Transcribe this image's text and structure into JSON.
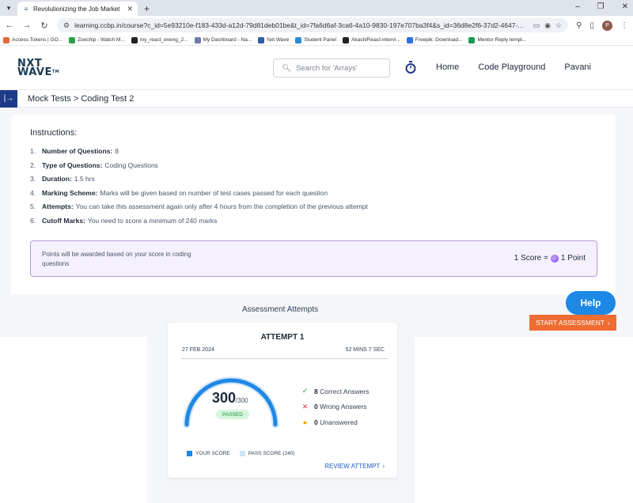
{
  "browser": {
    "tab_title": "Revolutionizing the Job Market",
    "url": "learning.ccbp.in/course?c_id=5e93210e-f183-433d-a12d-79d81deb01be&t_id=7fa6d6af-3ca6-4a10-9830-197e707ba3f4&s_id=36d8e2f6-37d2-4647-...",
    "profile_initial": "P",
    "bookmarks": [
      {
        "label": "Access Tokens | GO...",
        "color": "#e0693a"
      },
      {
        "label": "Zoechip - Watch M...",
        "color": "#2e9e4c"
      },
      {
        "label": "my_react_eveng_2...",
        "color": "#222222"
      },
      {
        "label": "My Dashboard - Na...",
        "color": "#6b7ca8"
      },
      {
        "label": "Nxt Wave",
        "color": "#2f5da8"
      },
      {
        "label": "Student Panel",
        "color": "#2a8bd4"
      },
      {
        "label": "Akash/React-intervi...",
        "color": "#222222"
      },
      {
        "label": "Freepik: Download...",
        "color": "#2f6ee0"
      },
      {
        "label": "Mentor Reply templ...",
        "color": "#1a9c52"
      }
    ]
  },
  "header": {
    "logo_line1": "NXT",
    "logo_line2": "WAVE",
    "logo_tm": "TM",
    "search_placeholder": "Search for 'Arrays'",
    "nav": [
      "Home",
      "Code Playground",
      "Pavani"
    ]
  },
  "breadcrumb": "Mock Tests > Coding Test 2",
  "instructions": {
    "title": "Instructions:",
    "items": [
      {
        "num": "1.",
        "key": "Number of Questions:",
        "value": "8"
      },
      {
        "num": "2.",
        "key": "Type of Questions:",
        "value": "Coding Questions"
      },
      {
        "num": "3.",
        "key": "Duration:",
        "value": "1.5 hrs"
      },
      {
        "num": "4.",
        "key": "Marking Scheme:",
        "value": "Marks will be given based on number of test cases passed for each question"
      },
      {
        "num": "5.",
        "key": "Attempts:",
        "value": "You can take this assessment again only after 4 hours from the completion of the previous attempt"
      },
      {
        "num": "6.",
        "key": "Cutoff Marks:",
        "value": "You need to score a minimum of 240 marks"
      }
    ],
    "points_text": "Points will be awarded based on your score in coding questions",
    "score_left": "1 Score =",
    "score_right": "1 Point"
  },
  "attempts": {
    "title": "Assessment Attempts",
    "help_label": "Help",
    "start_label": "START ASSESSMENT",
    "attempt": {
      "heading": "ATTEMPT 1",
      "date": "27 FEB 2024",
      "duration": "52 MINS 7 SEC",
      "score": "300",
      "max": "/300",
      "score_fraction": 1.0,
      "pass_fraction": 0.8,
      "status": "PASSED",
      "correct": "8",
      "correct_label": "Correct Answers",
      "wrong": "0",
      "wrong_label": "Wrong Answers",
      "unanswered": "0",
      "unanswered_label": "Unanswered",
      "legend_your": "YOUR SCORE",
      "legend_pass": "PASS SCORE (240)",
      "review_label": "REVIEW ATTEMPT"
    }
  },
  "colors": {
    "accent": "#1e88e5",
    "start": "#ef6c33",
    "pass_track": "#cfe3f7",
    "success": "#1f8f3a",
    "error": "#e53935",
    "warning": "#f0a500"
  }
}
